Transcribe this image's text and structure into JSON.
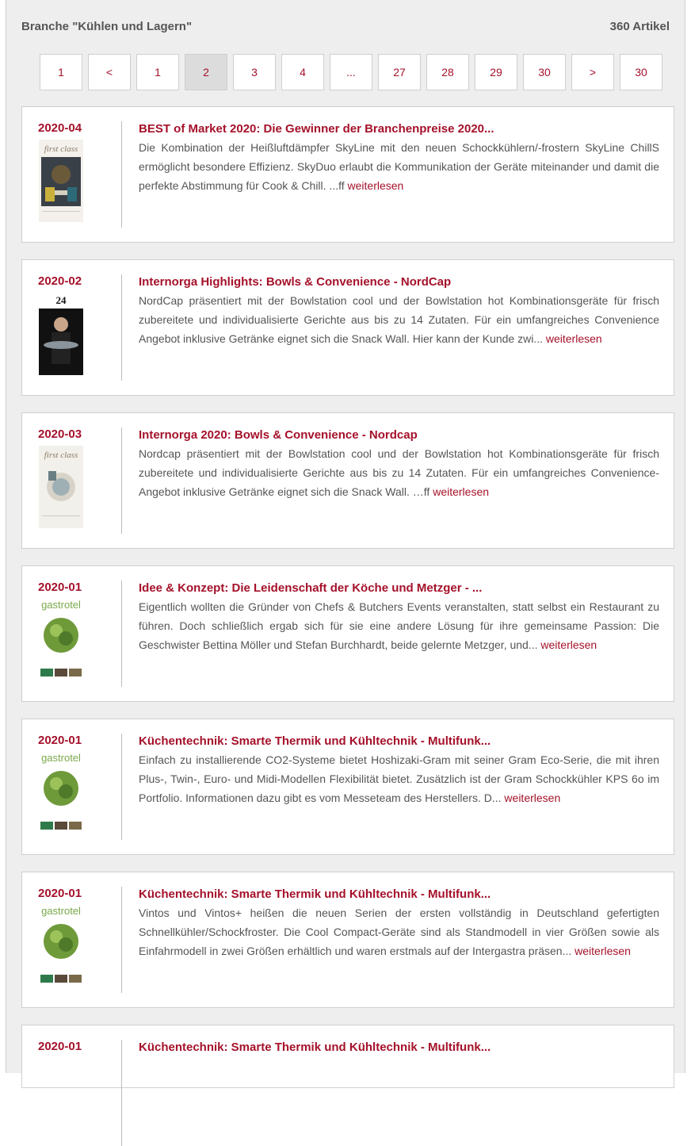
{
  "header": {
    "title": "Branche \"Kühlen und Lagern\"",
    "count": "360 Artikel"
  },
  "pagination": [
    "1",
    "<",
    "1",
    "2",
    "3",
    "4",
    "...",
    "27",
    "28",
    "29",
    "30",
    ">",
    "30"
  ],
  "pagination_active": "2",
  "colors": {
    "accent": "#a5112a",
    "panel": "#eeeeee",
    "text": "#555555"
  },
  "read_more_label": "weiterlesen",
  "articles": [
    {
      "date": "2020-04",
      "cover": "first class",
      "title": "BEST of Market 2020: Die Gewinner der Branchenpreise 2020...",
      "text": "Die Kombination der Heißluftdämpfer SkyLine mit den neuen Schockkühlern/-frostern SkyLine ChillS ermöglicht besondere Effizienz. SkyDuo erlaubt die Kommunikation der Geräte miteinander und damit die perfekte Abstimmung für Cook & Chill. ...ff"
    },
    {
      "date": "2020-02",
      "cover": "24",
      "title": "Internorga Highlights: Bowls & Convenience - NordCap",
      "text": "NordCap präsentiert mit der Bowlstation cool und der Bowlstation hot Kombinationsgeräte für frisch zubereitete und individualisierte Gerichte aus bis zu 14 Zutaten. Für ein umfangreiches Convenience Angebot inklusive Getränke eignet sich die Snack Wall. Hier kann der Kunde zwi..."
    },
    {
      "date": "2020-03",
      "cover": "first class",
      "title": "Internorga 2020: Bowls & Convenience - Nordcap",
      "text": "Nordcap präsentiert mit der Bowlstation cool und der Bowlstation hot Kombinationsgeräte für frisch zubereitete und individualisierte Gerichte aus bis zu 14 Zutaten. Für ein umfangreiches Convenience-Angebot inklusive Getränke eignet sich die Snack Wall. …ff"
    },
    {
      "date": "2020-01",
      "cover": "gastrotel",
      "title": "Idee & Konzept: Die Leidenschaft der Köche und Metzger - ...",
      "text": "Eigentlich wollten die Gründer von Chefs & Butchers Events veranstalten, statt selbst ein Restaurant zu führen. Doch schließlich ergab sich für sie eine andere Lösung für ihre gemeinsame Passion: Die Geschwister Bettina Möller und Stefan Burchhardt, beide gelernte Metzger, und..."
    },
    {
      "date": "2020-01",
      "cover": "gastrotel",
      "title": "Küchentechnik: Smarte Thermik und Kühltechnik - Multifunk...",
      "text": "Einfach zu installierende CO2-Systeme bietet Hoshizaki-Gram mit seiner Gram Eco-Serie, die mit ihren Plus-, Twin-, Euro- und Midi-Modellen Flexibilität bietet. Zusätzlich ist der Gram Schockkühler KPS 6o im Portfolio. Informationen dazu gibt es vom Messeteam des Herstellers. D..."
    },
    {
      "date": "2020-01",
      "cover": "gastrotel",
      "title": "Küchentechnik: Smarte Thermik und Kühltechnik - Multifunk...",
      "text": "Vintos und Vintos+ heißen die neuen Serien der ersten vollständig in Deutschland gefertigten Schnellkühler/Schockfroster. Die Cool Compact-Geräte sind als Standmodell in vier Größen sowie als Einfahrmodell in zwei Größen erhältlich und waren erstmals auf der Intergastra präsen..."
    },
    {
      "date": "2020-01",
      "cover": "",
      "title": "Küchentechnik: Smarte Thermik und Kühltechnik - Multifunk...",
      "text": ""
    }
  ]
}
